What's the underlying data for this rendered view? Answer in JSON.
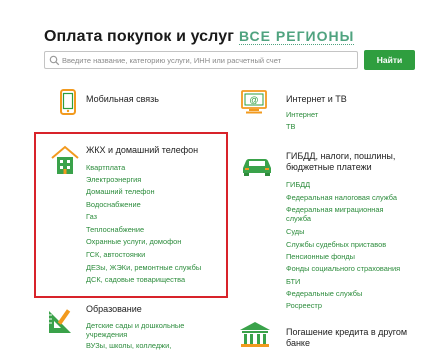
{
  "header": {
    "title": "Оплата покупок и услуг",
    "regions_link": "ВСЕ РЕГИОНЫ"
  },
  "search": {
    "placeholder": "Введите название, категорию услуги, ИНН или расчетный счет",
    "button_label": "Найти"
  },
  "colors": {
    "accent_green": "#2f9e3f",
    "link_green": "#2c8c3c",
    "highlight_red": "#d8232a",
    "icon_orange": "#f29a1e"
  },
  "categories": {
    "mobile": {
      "title": "Мобильная связь",
      "icon": "mobile-phone-icon"
    },
    "internet": {
      "title": "Интернет и ТВ",
      "icon": "internet-tv-icon",
      "links": [
        "Интернет",
        "ТВ"
      ]
    },
    "housing": {
      "title": "ЖКХ и домашний телефон",
      "icon": "house-icon",
      "links": [
        "Квартплата",
        "Электроэнергия",
        "Домашний телефон",
        "Водоснабжение",
        "Газ",
        "Теплоснабжение",
        "Охранные услуги, домофон",
        "ГСК, автостоянки",
        "ДЕЗы, ЖЭКи, ремонтные службы",
        "ДСК, садовые товарищества"
      ]
    },
    "gibdd": {
      "title_line1": "ГИБДД, налоги, пошлины,",
      "title_line2": "бюджетные платежи",
      "icon": "car-icon",
      "links": [
        "ГИБДД",
        "Федеральная налоговая служба",
        "Федеральная миграционная",
        "служба",
        "Суды",
        "Службы судебных приставов",
        "Пенсионные фонды",
        "Фонды социального страхования",
        "БТИ",
        "Федеральные службы",
        "Росреестр"
      ]
    },
    "education": {
      "title": "Образование",
      "icon": "ruler-icon",
      "links": [
        "Детские сады и дошкольные",
        "учреждения",
        "ВУЗы, школы, колледжи,"
      ]
    },
    "loan": {
      "title_line1": "Погашение кредита в другом",
      "title_line2": "банке",
      "icon": "bank-icon"
    }
  }
}
